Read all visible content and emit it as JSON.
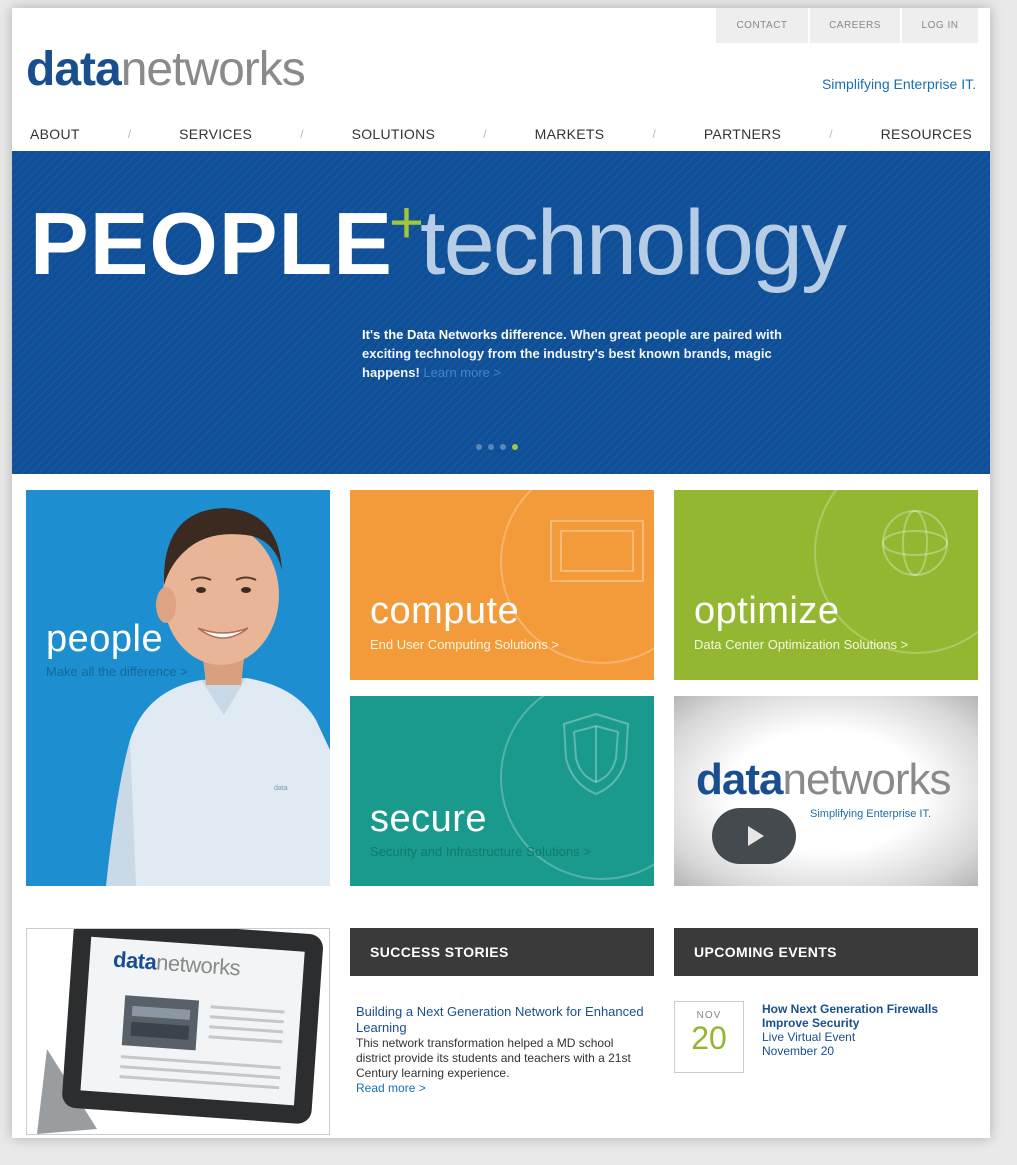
{
  "util_nav": [
    "CONTACT",
    "CAREERS",
    "LOG IN"
  ],
  "logo": {
    "bold": "data",
    "light": "networks"
  },
  "tagline": "Simplifying Enterprise IT.",
  "nav": {
    "items": [
      "ABOUT",
      "SERVICES",
      "SOLUTIONS",
      "MARKETS",
      "PARTNERS",
      "RESOURCES"
    ],
    "separator": "/"
  },
  "hero": {
    "title_bold": "PEOPLE",
    "title_plus": "+",
    "title_light": "technology",
    "lead": "It's the Data Networks difference.",
    "body": " When great people are paired with exciting technology from the industry's best known brands, magic happens!",
    "more": "Learn more >",
    "slides": 4,
    "active_slide": 4
  },
  "tiles": {
    "people": {
      "title": "people",
      "sub": "Make all the difference >"
    },
    "compute": {
      "title": "compute",
      "sub": "End User Computing Solutions >"
    },
    "optimize": {
      "title": "optimize",
      "sub": "Data Center Optimization Solutions >"
    },
    "secure": {
      "title": "secure",
      "sub": "Security and Infrastructure Solutions >"
    },
    "video": {
      "logo_bold": "data",
      "logo_light": "networks",
      "tagline": "Simplifying Enterprise IT."
    }
  },
  "tablet": {
    "logo_bold": "data",
    "logo_light": "networks"
  },
  "success_stories": {
    "heading": "SUCCESS STORIES",
    "title": "Building a Next Generation Network for Enhanced Learning",
    "body": "This network transformation helped a MD school district provide its students and teachers with a 21st Century learning experience.",
    "more": "Read more >"
  },
  "events": {
    "heading": "UPCOMING EVENTS",
    "month": "NOV",
    "day": "20",
    "title": "How Next Generation Firewalls Improve Security",
    "type": "Live Virtual Event",
    "date": "November 20"
  },
  "colors": {
    "brand_blue": "#1a4f8f",
    "hero_blue": "#0e4f97",
    "accent_green": "#a4c639",
    "compute_orange": "#f39b3b",
    "optimize_green": "#93b730",
    "secure_teal": "#1a9a8c",
    "people_blue": "#1d8fd0"
  }
}
